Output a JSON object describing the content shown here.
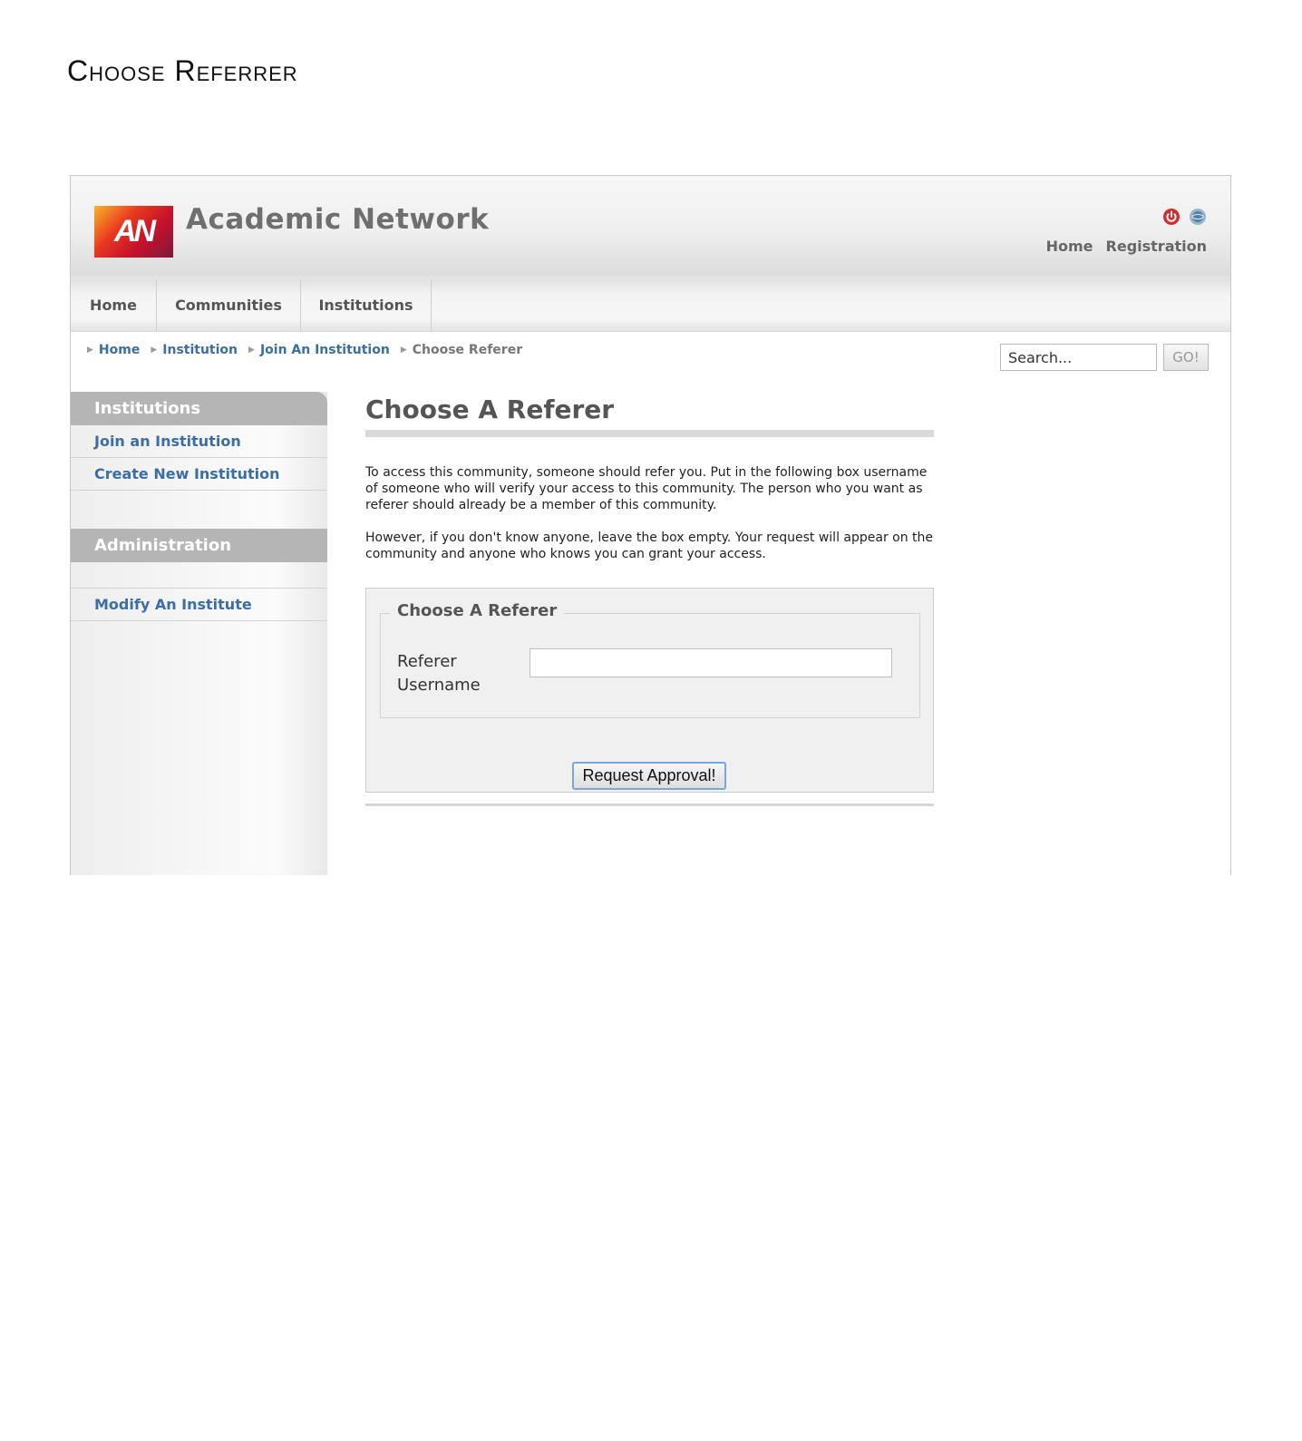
{
  "document": {
    "heading": "Choose Referrer"
  },
  "site": {
    "logo_text": "AN",
    "title": "Academic Network",
    "top_links": [
      "Home",
      "Registration"
    ],
    "icons": [
      "logout-icon",
      "globe-icon"
    ],
    "colors": {
      "link": "#3a6ea5",
      "sidebar_header": "#b5b5b5",
      "logo": "#d9212a"
    }
  },
  "nav": {
    "tabs": [
      "Home",
      "Communities",
      "Institutions"
    ]
  },
  "breadcrumb": [
    "Home",
    "Institution",
    "Join An Institution",
    "Choose Referer"
  ],
  "search": {
    "value": "Search...",
    "button": "GO!"
  },
  "sidebar": {
    "sections": [
      {
        "header": "Institutions",
        "items": [
          "Join an Institution",
          "Create New Institution"
        ]
      },
      {
        "header": "Administration",
        "items": [
          "Modify An Institute"
        ]
      }
    ]
  },
  "main": {
    "title": "Choose A Referer",
    "paragraph1": "To access this community, someone should refer you. Put in the following box username of someone who will verify your access to this community. The person who you want as referer should already be a member of this community.",
    "paragraph2": "However, if you don't know anyone, leave the box empty. Your request will appear on the community and anyone who knows you can grant your access.",
    "form": {
      "legend": "Choose A Referer",
      "field_label": "Referer Username",
      "field_value": "",
      "submit": "Request Approval!"
    }
  }
}
